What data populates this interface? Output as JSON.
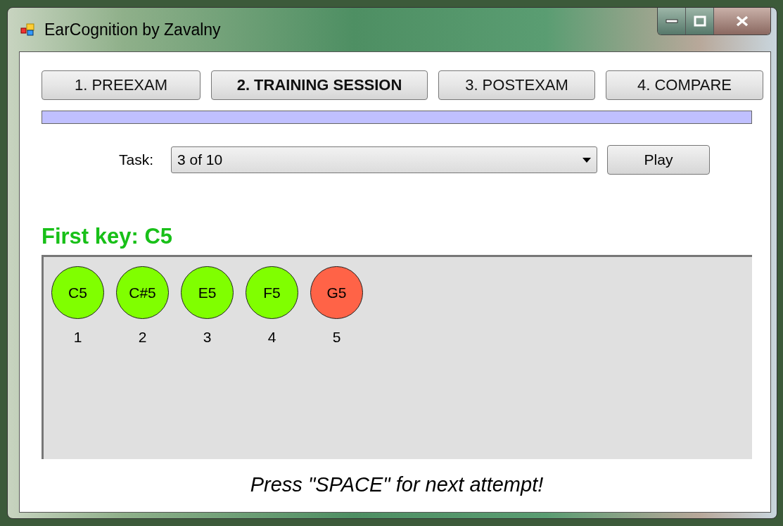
{
  "window": {
    "title": "EarCognition by Zavalny"
  },
  "tabs": [
    {
      "label": "1. PREEXAM",
      "selected": false
    },
    {
      "label": "2. TRAINING SESSION",
      "selected": true
    },
    {
      "label": "3. POSTEXAM",
      "selected": false
    },
    {
      "label": "4. COMPARE",
      "selected": false
    }
  ],
  "progress": {
    "level": 1
  },
  "task": {
    "label": "Task:",
    "value": "3 of 10"
  },
  "play_button": "Play",
  "first_key": "First key: C5",
  "notes": [
    {
      "name": "C5",
      "number": "1",
      "color": "#80ff00"
    },
    {
      "name": "C#5",
      "number": "2",
      "color": "#80ff00"
    },
    {
      "name": "E5",
      "number": "3",
      "color": "#80ff00"
    },
    {
      "name": "F5",
      "number": "4",
      "color": "#80ff00"
    },
    {
      "name": "G5",
      "number": "5",
      "color": "#ff6347"
    }
  ],
  "footer": "Press \"SPACE\" for next attempt!"
}
